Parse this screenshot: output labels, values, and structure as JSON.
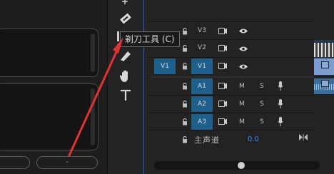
{
  "left_panel": {
    "pill_left_label": "",
    "pill_right_label": "-"
  },
  "tooltip": {
    "text": "剃刀工具 (C)"
  },
  "timeline": {
    "video_tracks": [
      {
        "name": "V3"
      },
      {
        "name": "V2"
      },
      {
        "name": "V1",
        "source_patch": "V1"
      }
    ],
    "audio_tracks": [
      {
        "name": "A1",
        "mute": "M",
        "solo": "S"
      },
      {
        "name": "A2",
        "mute": "M",
        "solo": "S"
      },
      {
        "name": "A3",
        "mute": "M",
        "solo": "S"
      }
    ],
    "master": {
      "label": "主声道",
      "value": "0.0"
    }
  },
  "colors": {
    "track_target": "#1f5f8b",
    "playhead": "#2a5bd6",
    "annotation_arrow": "#e23232",
    "master_value": "#2f8cff"
  },
  "icons": [
    "razor-icon",
    "pen-icon",
    "hand-icon",
    "text-tool-icon",
    "lock-icon",
    "film-icon",
    "eye-icon",
    "mic-icon"
  ]
}
